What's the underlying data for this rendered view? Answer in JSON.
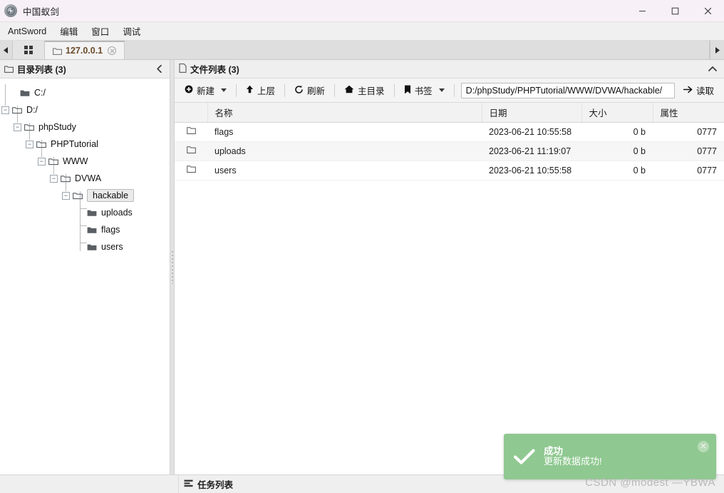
{
  "window": {
    "title": "中国蚁剑",
    "app_icon": "antsword-logo-icon",
    "minimize_label": "—",
    "maximize_label": "□",
    "close_label": "✕"
  },
  "menubar": {
    "items": [
      {
        "label": "AntSword",
        "name": "menu-antsword"
      },
      {
        "label": "编辑",
        "name": "menu-edit"
      },
      {
        "label": "窗口",
        "name": "menu-window"
      },
      {
        "label": "调试",
        "name": "menu-debug"
      }
    ]
  },
  "tabbar": {
    "scroll_left": "◀",
    "scroll_right": "▶",
    "grid_tab_name": "shell-list-tab",
    "tabs": [
      {
        "label": "127.0.0.1",
        "icon": "folder-icon",
        "close": "✕",
        "active": true
      }
    ]
  },
  "left_panel": {
    "icon": "folder-icon",
    "title": "目录列表 (3)",
    "collapse_icon": "chevron-left-icon",
    "tree": [
      {
        "label": "C:/",
        "depth": 0,
        "toggle": "",
        "icon": "folder-solid-icon",
        "selected": false
      },
      {
        "label": "D:/",
        "depth": 0,
        "toggle": "−",
        "icon": "folder-open-icon",
        "selected": false
      },
      {
        "label": "phpStudy",
        "depth": 1,
        "toggle": "−",
        "icon": "folder-open-icon",
        "selected": false
      },
      {
        "label": "PHPTutorial",
        "depth": 2,
        "toggle": "−",
        "icon": "folder-open-icon",
        "selected": false
      },
      {
        "label": "WWW",
        "depth": 3,
        "toggle": "−",
        "icon": "folder-open-icon",
        "selected": false
      },
      {
        "label": "DVWA",
        "depth": 4,
        "toggle": "−",
        "icon": "folder-open-icon",
        "selected": false
      },
      {
        "label": "hackable",
        "depth": 5,
        "toggle": "−",
        "icon": "folder-open-icon",
        "selected": true
      },
      {
        "label": "uploads",
        "depth": 6,
        "toggle": "",
        "icon": "folder-solid-icon",
        "selected": false
      },
      {
        "label": "flags",
        "depth": 6,
        "toggle": "",
        "icon": "folder-solid-icon",
        "selected": false
      },
      {
        "label": "users",
        "depth": 6,
        "toggle": "",
        "icon": "folder-solid-icon",
        "selected": false
      }
    ]
  },
  "right_panel": {
    "icon": "file-icon",
    "title": "文件列表 (3)",
    "collapse_icon": "chevron-up-icon",
    "toolbar": {
      "new_label": "新建",
      "new_icon": "plus-circle-icon",
      "up_label": "上层",
      "up_icon": "arrow-up-icon",
      "refresh_label": "刷新",
      "refresh_icon": "refresh-icon",
      "home_label": "主目录",
      "home_icon": "home-icon",
      "bookmark_label": "书签",
      "bookmark_icon": "bookmark-icon",
      "read_label": "读取",
      "read_icon": "arrow-right-icon",
      "path_value": "D:/phpStudy/PHPTutorial/WWW/DVWA/hackable/",
      "path_placeholder": "D:/phpStudy/PHPTutorial/WWW/DVWA/hackable/"
    },
    "table": {
      "columns": [
        "",
        "名称",
        "日期",
        "大小",
        "属性"
      ],
      "rows": [
        {
          "icon": "folder-icon",
          "name": "flags",
          "date": "2023-06-21 10:55:58",
          "size": "0 b",
          "attr": "0777"
        },
        {
          "icon": "folder-icon",
          "name": "uploads",
          "date": "2023-06-21 11:19:07",
          "size": "0 b",
          "attr": "0777"
        },
        {
          "icon": "folder-icon",
          "name": "users",
          "date": "2023-06-21 10:55:58",
          "size": "0 b",
          "attr": "0777"
        }
      ]
    }
  },
  "statusbar": {
    "icon": "list-icon",
    "title": "任务列表"
  },
  "toast": {
    "icon": "check-icon",
    "title": "成功",
    "message": "更新数据成功!",
    "close": "✕",
    "color": "#8fc890"
  },
  "watermark": {
    "text": "CSDN @modest —YBWA"
  }
}
